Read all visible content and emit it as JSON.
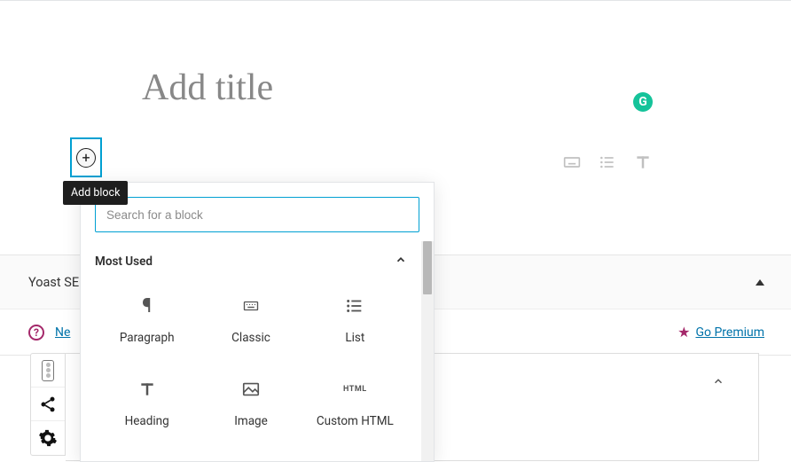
{
  "title_placeholder": "Add title",
  "grammarly_label": "G",
  "add_block_tooltip": "Add block",
  "inserter": {
    "search_placeholder": "Search for a block",
    "section_title": "Most Used",
    "items": [
      {
        "label": "Paragraph"
      },
      {
        "label": "Classic"
      },
      {
        "label": "List"
      },
      {
        "label": "Heading"
      },
      {
        "label": "Image"
      },
      {
        "label": "Custom HTML"
      }
    ]
  },
  "yoast": {
    "title": "Yoast SEO",
    "help_link": "Ne",
    "go_premium": "Go Premium"
  }
}
